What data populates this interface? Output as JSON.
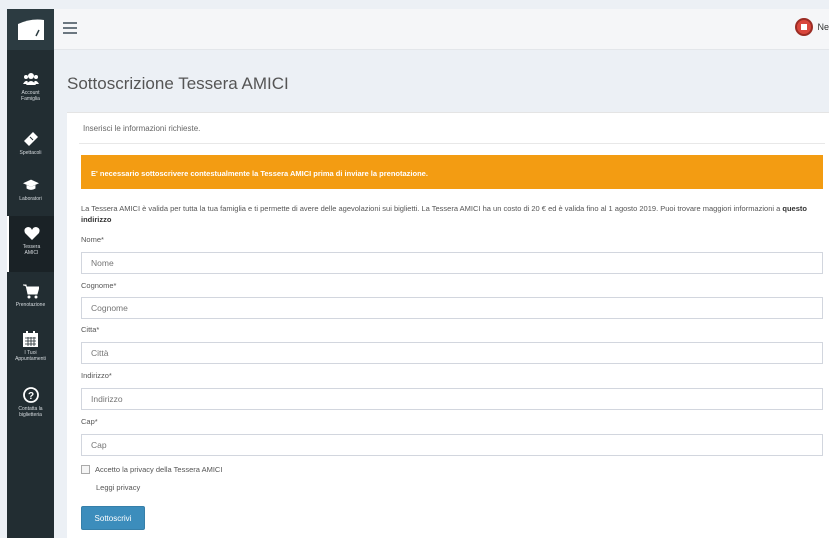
{
  "app": {
    "user_name": "Ne"
  },
  "sidebar": {
    "items": [
      {
        "label": "Account\nFamiglia",
        "icon": "users-icon"
      },
      {
        "label": "Spettacoli",
        "icon": "ticket-icon"
      },
      {
        "label": "Laboratori",
        "icon": "graduation-cap-icon"
      },
      {
        "label": "Tessera\nAMICI",
        "icon": "heart-icon",
        "active": true
      },
      {
        "label": "Prenotazione",
        "icon": "cart-icon"
      },
      {
        "label": "I Tuoi\nAppuntamenti",
        "icon": "calendar-icon"
      },
      {
        "label": "Contatta la\nbiglietteria",
        "icon": "question-icon"
      }
    ]
  },
  "page": {
    "title": "Sottoscrizione Tessera AMICI",
    "subtitle": "Inserisci le informazioni richieste.",
    "alert": "E' necessario sottoscrivere contestualmente la Tessera AMICI prima di inviare la prenotazione.",
    "info_text": "La Tessera AMICI è valida per tutta la tua famiglia e ti permette di avere delle agevolazioni sui biglietti. La Tessera AMICI ha un costo di 20 € ed è valida fino al 1 agosto 2019. Puoi trovare maggiori informazioni a ",
    "info_link": "questo indirizzo"
  },
  "form": {
    "nome": {
      "label": "Nome*",
      "placeholder": "Nome"
    },
    "cognome": {
      "label": "Cognome*",
      "placeholder": "Cognome"
    },
    "citta": {
      "label": "Citta*",
      "placeholder": "Città"
    },
    "indirizzo": {
      "label": "Indirizzo*",
      "placeholder": "Indirizzo"
    },
    "cap": {
      "label": "Cap*",
      "placeholder": "Cap"
    },
    "privacy_checkbox": "Accetto la privacy della Tessera AMICI",
    "privacy_link": "Leggi privacy",
    "submit": "Sottoscrivi"
  },
  "colors": {
    "sidebar": "#222d32",
    "alert": "#f39c12",
    "button": "#3c8dbc"
  }
}
